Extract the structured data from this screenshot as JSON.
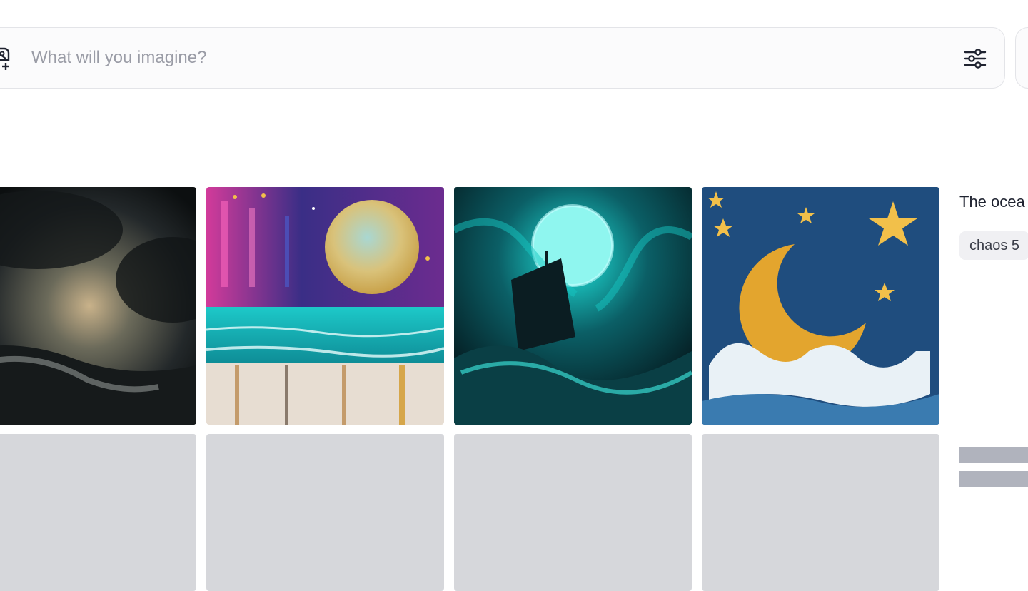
{
  "prompt_bar": {
    "placeholder": "What will you imagine?",
    "value": "",
    "add_image_icon": "image-plus-icon",
    "settings_icon": "sliders-icon"
  },
  "gallery": {
    "images": [
      {
        "name": "image-stormy-sea",
        "description": "stormy dark sea"
      },
      {
        "name": "image-moon-painting",
        "description": "full moon over turquoise sea"
      },
      {
        "name": "image-ghost-ship",
        "description": "ship under glowing moon"
      },
      {
        "name": "image-crescent-moon",
        "description": "crescent moon with stars and waves"
      }
    ]
  },
  "job": {
    "title": "The ocea",
    "params": [
      "chaos 5"
    ]
  },
  "colors": {
    "placeholder_gray": "#d6d7db",
    "skeleton": "#b0b3bd"
  }
}
